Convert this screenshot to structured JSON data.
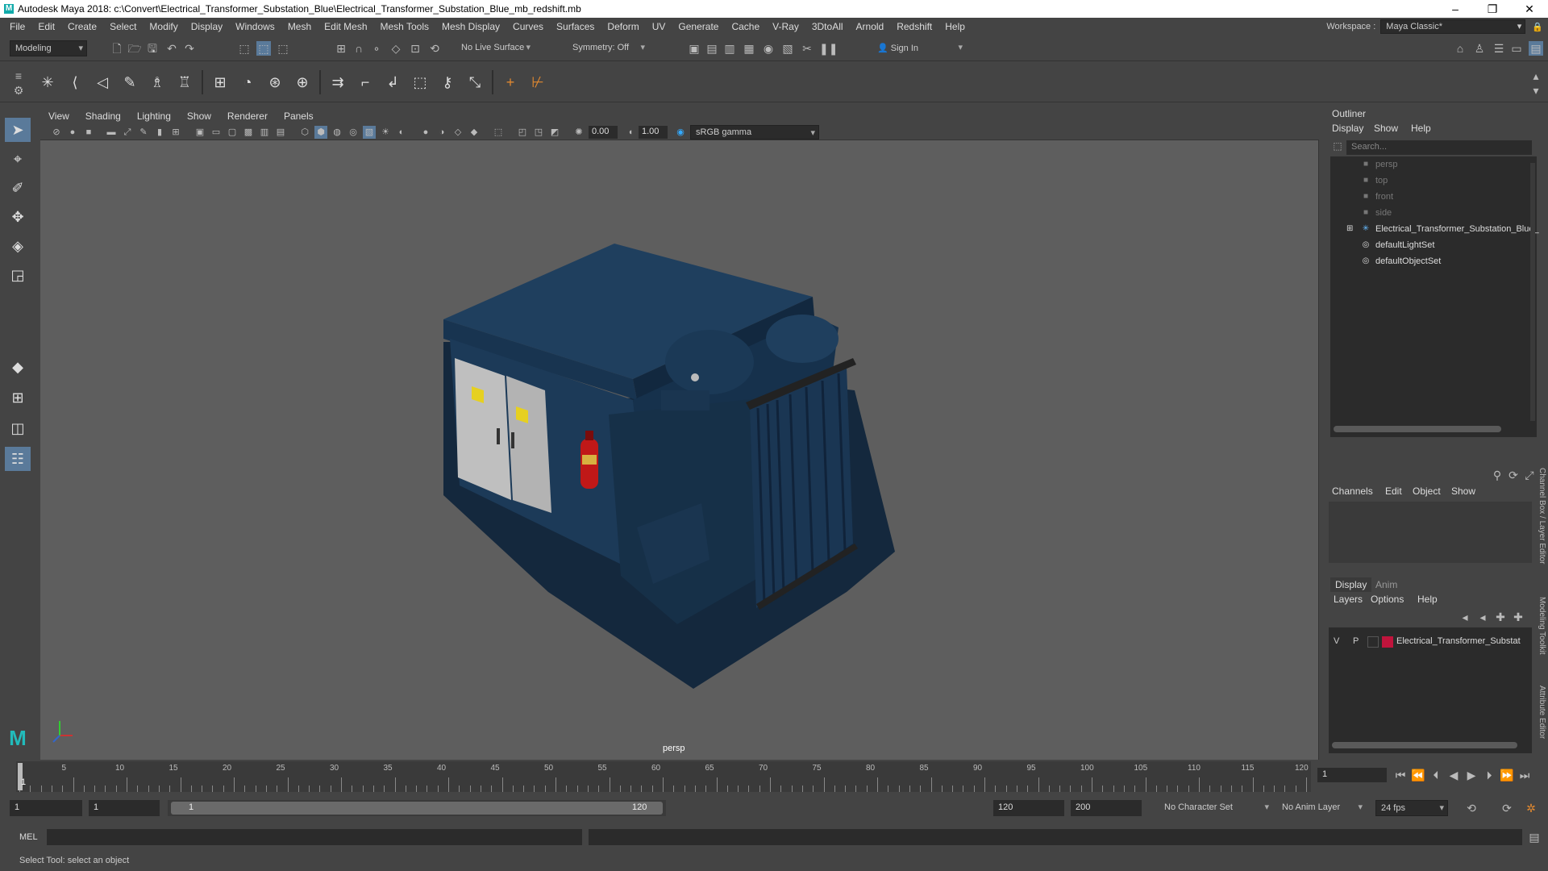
{
  "title": "Autodesk Maya 2018: c:\\Convert\\Electrical_Transformer_Substation_Blue\\Electrical_Transformer_Substation_Blue_mb_redshift.mb",
  "menu": [
    "File",
    "Edit",
    "Create",
    "Select",
    "Modify",
    "Display",
    "Windows",
    "Mesh",
    "Edit Mesh",
    "Mesh Tools",
    "Mesh Display",
    "Curves",
    "Surfaces",
    "Deform",
    "UV",
    "Generate",
    "Cache",
    "V-Ray",
    "3DtoAll",
    "Arnold",
    "Redshift",
    "Help"
  ],
  "workspace": {
    "label": "Workspace :",
    "value": "Maya Classic*"
  },
  "status": {
    "mode": "Modeling",
    "live": "No Live Surface",
    "symmetry": "Symmetry: Off",
    "signin": "Sign In"
  },
  "panel": {
    "menus": [
      "View",
      "Shading",
      "Lighting",
      "Show",
      "Renderer",
      "Panels"
    ],
    "exposure": "0.00",
    "gamma": "1.00",
    "colorspace": "sRGB gamma"
  },
  "viewport": {
    "camera": "persp"
  },
  "outliner": {
    "title": "Outliner",
    "menus": [
      "Display",
      "Show",
      "Help"
    ],
    "search": "Search...",
    "items": [
      {
        "label": "persp",
        "icon": "camera-icon",
        "dim": true
      },
      {
        "label": "top",
        "icon": "camera-icon",
        "dim": true
      },
      {
        "label": "front",
        "icon": "camera-icon",
        "dim": true
      },
      {
        "label": "side",
        "icon": "camera-icon",
        "dim": true
      },
      {
        "label": "Electrical_Transformer_Substation_Blue_",
        "icon": "group-icon",
        "dim": false
      },
      {
        "label": "defaultLightSet",
        "icon": "set-icon",
        "dim": false
      },
      {
        "label": "defaultObjectSet",
        "icon": "set-icon",
        "dim": false
      }
    ]
  },
  "channelbox": {
    "menus": [
      "Channels",
      "Edit",
      "Object",
      "Show"
    ]
  },
  "layers": {
    "tabs": [
      "Display",
      "Anim"
    ],
    "menus": [
      "Layers",
      "Options",
      "Help"
    ],
    "row": {
      "v": "V",
      "p": "P",
      "name": "Electrical_Transformer_Substat",
      "color": "#c0143c"
    }
  },
  "sidetabs": [
    "Channel Box / Layer Editor",
    "Modeling Toolkit",
    "Attribute Editor"
  ],
  "timeline": {
    "ticks": [
      "5",
      "10",
      "15",
      "20",
      "25",
      "30",
      "35",
      "40",
      "45",
      "50",
      "55",
      "60",
      "65",
      "70",
      "75",
      "80",
      "85",
      "90",
      "95",
      "100",
      "105",
      "110",
      "115",
      "120"
    ],
    "current": "1",
    "frame_field": "1"
  },
  "range": {
    "start": "1",
    "inner_start": "1",
    "slider_start": "1",
    "slider_end": "120",
    "end": "120",
    "max": "200",
    "charset": "No Character Set",
    "animlayer": "No Anim Layer",
    "fps": "24 fps"
  },
  "cmd": {
    "label": "MEL"
  },
  "help": "Select Tool: select an object"
}
